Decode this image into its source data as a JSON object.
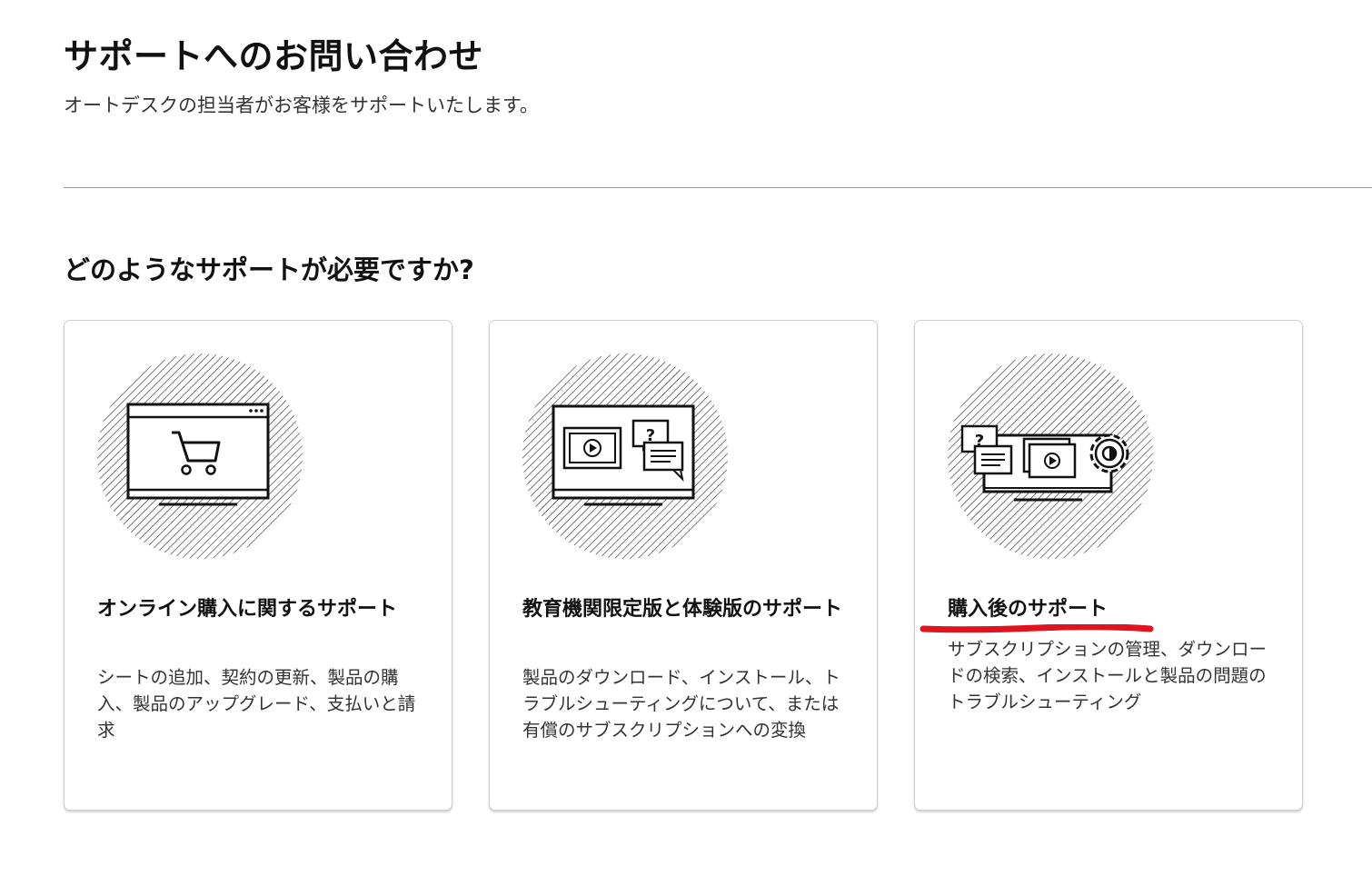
{
  "header": {
    "title": "サポートへのお問い合わせ",
    "subtitle": "オートデスクの担当者がお客様をサポートいたします。"
  },
  "section": {
    "title": "どのようなサポートが必要ですか?"
  },
  "cards": [
    {
      "icon": "shopping-cart-monitor-icon",
      "title": "オンライン購入に関するサポート",
      "description": "シートの追加、契約の更新、製品の購入、製品のアップグレード、支払いと請求"
    },
    {
      "icon": "video-chat-monitor-icon",
      "title": "教育機関限定版と体験版のサポート",
      "description": "製品のダウンロード、インストール、トラブルシューティングについて、または有償のサブスクリプションへの変換"
    },
    {
      "icon": "settings-video-chat-monitor-icon",
      "title": "購入後のサポート",
      "description": "サブスクリプションの管理、ダウンロードの検索、インストールと製品の問題のトラブルシューティング"
    }
  ],
  "colors": {
    "annotation": "#e0141e",
    "divider": "#9a9a9a",
    "card_border": "#cfcfcf"
  }
}
